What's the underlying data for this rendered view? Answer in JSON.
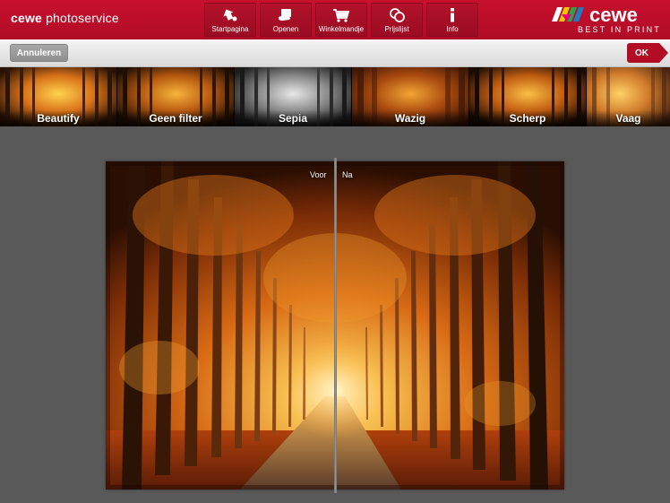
{
  "header": {
    "brand_bold": "cewe",
    "brand_light": "photoservice",
    "logo_word": "cewe",
    "logo_tagline": "BEST IN PRINT",
    "nav": [
      {
        "label": "Startpagina",
        "icon": "home-arrow-icon"
      },
      {
        "label": "Openen",
        "icon": "open-hand-icon"
      },
      {
        "label": "Winkelmandje",
        "icon": "cart-icon"
      },
      {
        "label": "Prijslijst",
        "icon": "coins-icon"
      },
      {
        "label": "Info",
        "icon": "info-icon"
      }
    ]
  },
  "actionbar": {
    "cancel_label": "Annuleren",
    "ok_label": "OK"
  },
  "filters": [
    {
      "label": "Beautify",
      "tone": "warm-bright"
    },
    {
      "label": "Geen filter",
      "tone": "warm"
    },
    {
      "label": "Sepia",
      "tone": "gray"
    },
    {
      "label": "Wazig",
      "tone": "warm-blur"
    },
    {
      "label": "Scherp",
      "tone": "warm"
    },
    {
      "label": "Vaag",
      "tone": "warm-soft"
    }
  ],
  "preview": {
    "before_label": "Voor",
    "after_label": "Na"
  },
  "colors": {
    "brand_red": "#c8102e",
    "canvas_gray": "#595959"
  }
}
